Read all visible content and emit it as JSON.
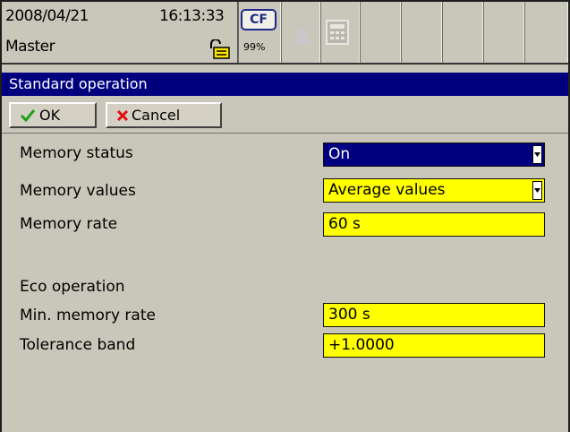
{
  "status_bar": {
    "date": "2008/04/21",
    "time": "16:13:33",
    "user": "Master",
    "storage_label": "CF",
    "storage_percent": "99%"
  },
  "dialog": {
    "title": "Standard operation",
    "ok_label": "OK",
    "cancel_label": "Cancel"
  },
  "form": {
    "memory_status": {
      "label": "Memory status",
      "value": "On"
    },
    "memory_values": {
      "label": "Memory values",
      "value": "Average values"
    },
    "memory_rate": {
      "label": "Memory rate",
      "value": "60 s"
    },
    "eco_heading": "Eco operation",
    "min_memory_rate": {
      "label": "Min. memory rate",
      "value": "300 s"
    },
    "tolerance_band": {
      "label": "Tolerance band",
      "value": "+1.0000"
    }
  },
  "icons": [
    "lock-icon",
    "cf-card-icon",
    "alarm-icon",
    "calculator-icon",
    "check-icon",
    "cross-icon",
    "dropdown-arrow-icon"
  ],
  "colors": {
    "title_bg": "#00007f",
    "field_yellow": "#ffff00",
    "selected_blue": "#00007f",
    "background": "#c9c7b9"
  }
}
